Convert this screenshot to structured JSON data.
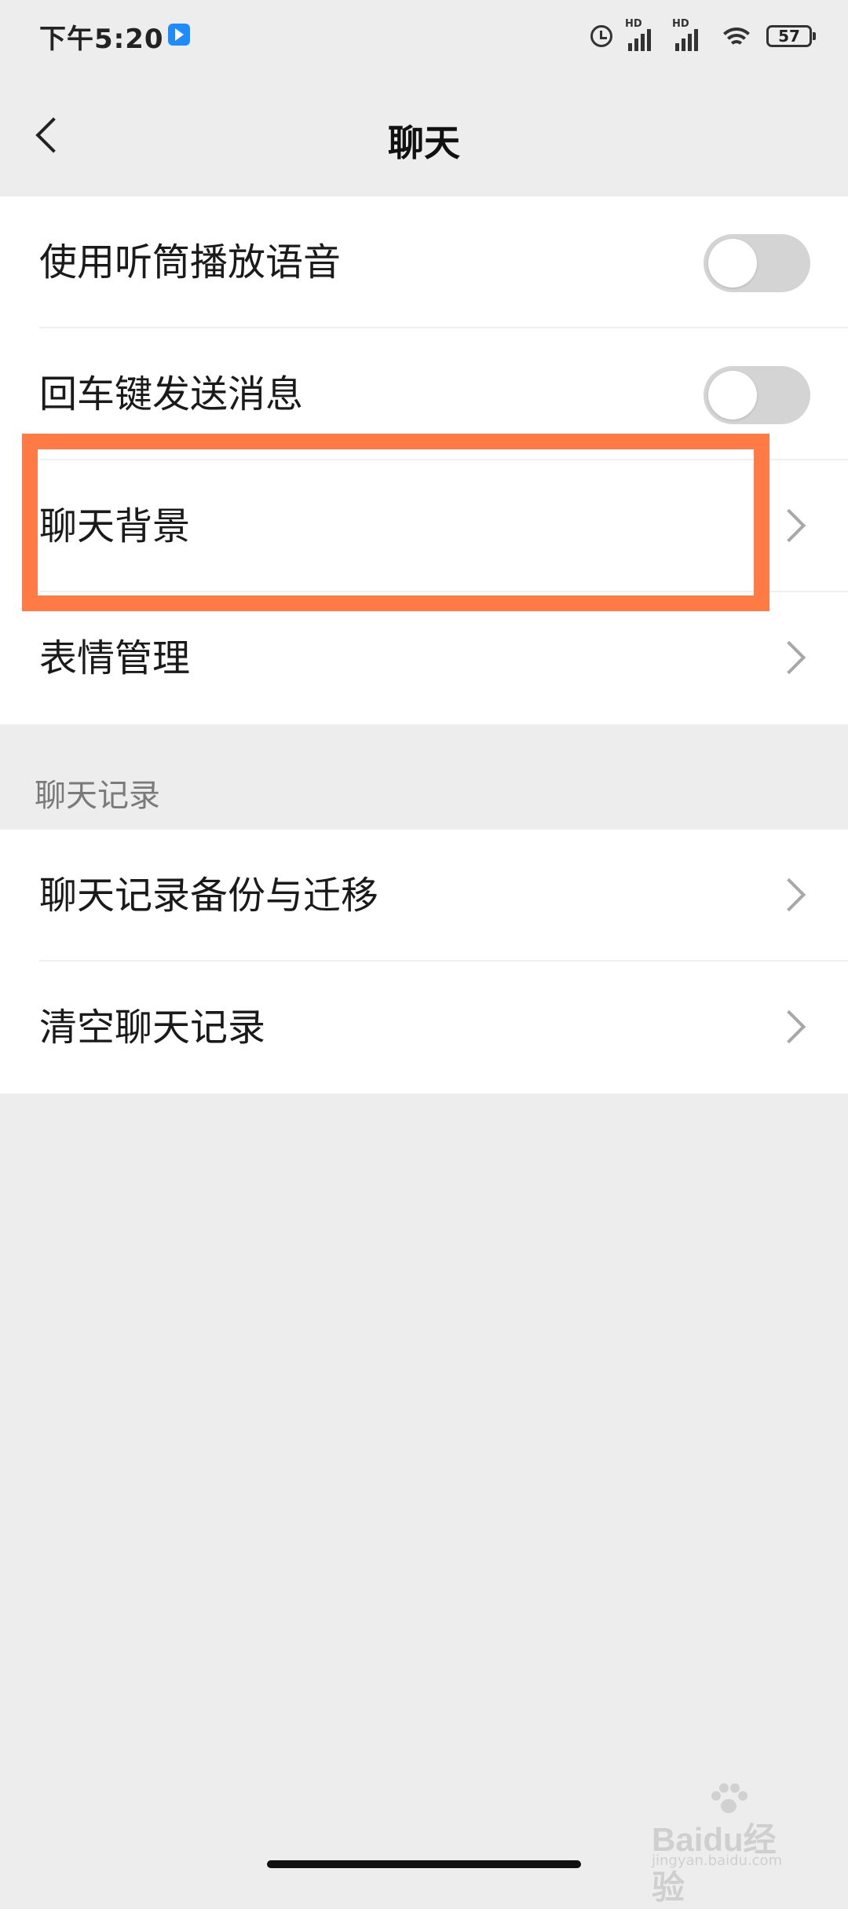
{
  "status_bar": {
    "time": "下午5:20",
    "battery": "57",
    "signal1_label": "HD",
    "signal2_label": "HD"
  },
  "header": {
    "title": "聊天",
    "back_icon": "chevron-left-icon"
  },
  "settings": {
    "items": [
      {
        "label": "使用听筒播放语音",
        "control": "toggle",
        "on": false
      },
      {
        "label": "回车键发送消息",
        "control": "toggle",
        "on": false
      },
      {
        "label": "聊天背景",
        "control": "chevron",
        "highlighted": true
      },
      {
        "label": "表情管理",
        "control": "chevron"
      }
    ]
  },
  "history": {
    "header": "聊天记录",
    "items": [
      {
        "label": "聊天记录备份与迁移",
        "control": "chevron"
      },
      {
        "label": "清空聊天记录",
        "control": "chevron"
      }
    ]
  },
  "watermark": {
    "main": "Baidu经验",
    "sub": "jingyan.baidu.com"
  },
  "colors": {
    "background": "#ededed",
    "highlight": "#ff7a45",
    "toggle_off": "#d4d4d4"
  }
}
